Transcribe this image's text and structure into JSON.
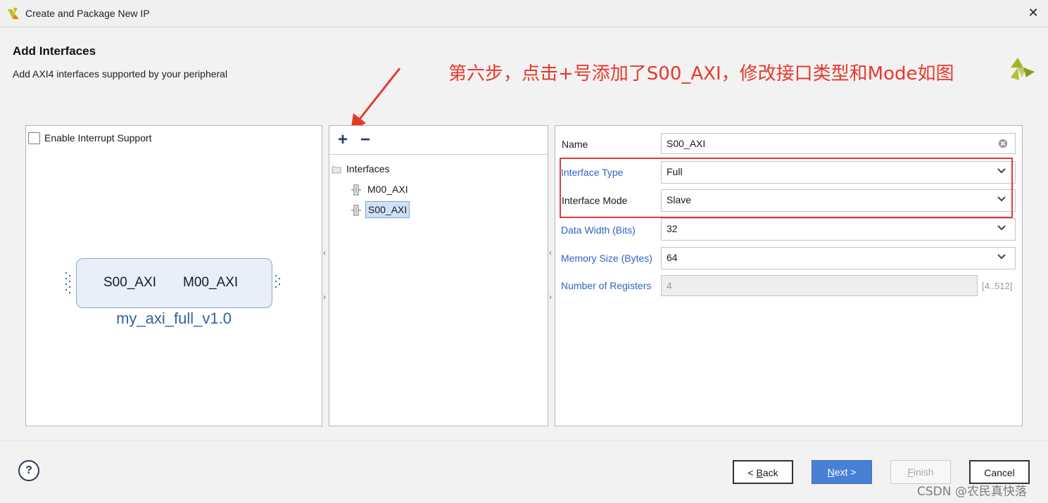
{
  "window": {
    "title": "Create and Package New IP",
    "close_label": "✕"
  },
  "header": {
    "title": "Add Interfaces",
    "subtitle": "Add AXI4 interfaces supported by your peripheral",
    "annotation": "第六步，点击+号添加了S00_AXI，修改接口类型和Mode如图"
  },
  "left_panel": {
    "checkbox_label": "Enable Interrupt Support",
    "checkbox_checked": false,
    "ip_block": {
      "slave_port": "S00_AXI",
      "master_port": "M00_AXI",
      "name": "my_axi_full_v1.0"
    }
  },
  "middle_panel": {
    "add_label": "+",
    "remove_label": "−",
    "tree": {
      "root": "Interfaces",
      "items": [
        {
          "label": "M00_AXI",
          "selected": false
        },
        {
          "label": "S00_AXI",
          "selected": true
        }
      ]
    }
  },
  "splitters": {
    "left_arrow": "‹",
    "right_arrow": "›"
  },
  "right_panel": {
    "name": {
      "label": "Name",
      "value": "S00_AXI"
    },
    "interface_type": {
      "label": "Interface Type",
      "value": "Full"
    },
    "interface_mode": {
      "label": "Interface Mode",
      "value": "Slave"
    },
    "data_width": {
      "label": "Data Width (Bits)",
      "value": "32"
    },
    "memory_size": {
      "label": "Memory Size (Bytes)",
      "value": "64"
    },
    "num_registers": {
      "label": "Number of Registers",
      "value": "4",
      "range": "[4..512]"
    }
  },
  "footer": {
    "help_label": "?",
    "back": {
      "prefix": "< ",
      "mnemonic": "B",
      "rest": "ack"
    },
    "next": {
      "mnemonic": "N",
      "rest": "ext >"
    },
    "finish": {
      "mnemonic": "F",
      "rest": "inish"
    },
    "cancel": "Cancel",
    "watermark": "CSDN @农民真快落"
  },
  "colors": {
    "accent_blue": "#4a7fd6",
    "label_blue": "#2a65c4",
    "annotation_red": "#e8382b"
  }
}
